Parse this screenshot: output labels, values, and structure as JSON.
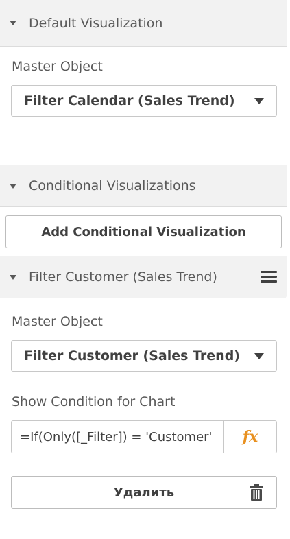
{
  "default_viz": {
    "header": "Default Visualization",
    "master_object_label": "Master Object",
    "master_object_value": "Filter Calendar (Sales Trend)"
  },
  "conditional_viz": {
    "header": "Conditional Visualizations",
    "add_button_label": "Add Conditional Visualization",
    "item": {
      "title": "Filter Customer (Sales Trend)",
      "master_object_label": "Master Object",
      "master_object_value": "Filter Customer (Sales Trend)",
      "condition_label": "Show Condition for Chart",
      "condition_value": "=If(Only([_Filter]) = 'Customer'",
      "fx_label": "fx",
      "delete_label": "Удалить"
    }
  },
  "icons": {
    "caret": "caret-down-icon",
    "dropdown_arrow": "dropdown-arrow-icon",
    "menu": "hamburger-menu-icon",
    "expression": "fx-expression-icon",
    "delete": "trash-icon"
  },
  "colors": {
    "header_bg": "#f2f2f2",
    "fx_accent": "#e8901f",
    "text": "#404040",
    "border": "#c8c8c8"
  }
}
